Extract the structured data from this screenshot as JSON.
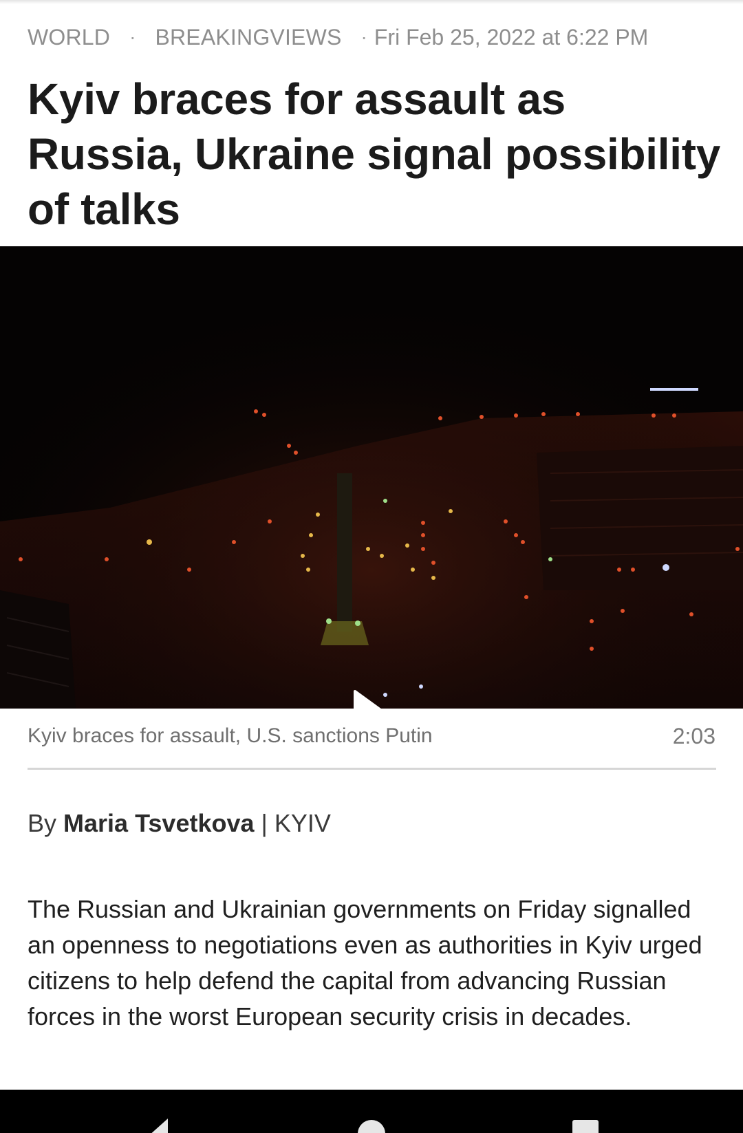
{
  "article": {
    "category": "WORLD",
    "section": "BREAKINGVIEWS",
    "separator": "·",
    "timestamp": "Fri Feb 25, 2022 at 6:22 PM",
    "headline": "Kyiv braces for assault as Russia, Ukraine signal possibility of talks",
    "byline": {
      "prefix": "By",
      "author": "Maria Tsvetkova",
      "divider": "|",
      "location": "KYIV"
    },
    "body": "The Russian and Ukrainian governments on Friday signalled an openness to negotiations even as authorities in Kyiv urged citizens to help defend the capital from advancing Russian forces in the worst European security crisis in decades."
  },
  "video": {
    "caption": "Kyiv braces for assault, U.S. sanctions Putin",
    "duration": "2:03",
    "play_icon": "play-icon"
  },
  "system_nav": {
    "back_icon": "back-triangle-icon",
    "home_icon": "home-circle-icon",
    "recents_icon": "recents-square-icon"
  },
  "colors": {
    "headline": "#1b1b1b",
    "meta": "#8e8e8e",
    "video_bg": "#050303",
    "city_lights": "#e0502a"
  }
}
